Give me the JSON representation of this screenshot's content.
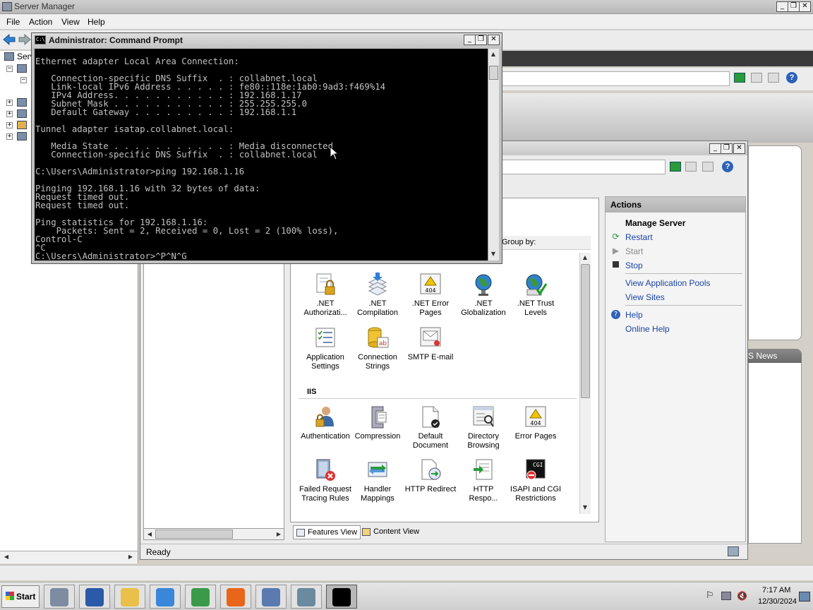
{
  "server_manager": {
    "title": "Server Manager",
    "menu": [
      "File",
      "Action",
      "View",
      "Help"
    ],
    "tree_label": "Serv",
    "news_header": "S News",
    "title_buttons": [
      "_",
      "❐",
      "✕"
    ]
  },
  "cmd": {
    "title": "Administrator: Command Prompt",
    "icon_text": "C:\\",
    "lines": [
      "Ethernet adapter Local Area Connection:",
      "",
      "   Connection-specific DNS Suffix  . : collabnet.local",
      "   Link-local IPv6 Address . . . . . : fe80::118e:1ab0:9ad3:f469%14",
      "   IPv4 Address. . . . . . . . . . . : 192.168.1.17",
      "   Subnet Mask . . . . . . . . . . . : 255.255.255.0",
      "   Default Gateway . . . . . . . . . : 192.168.1.1",
      "",
      "Tunnel adapter isatap.collabnet.local:",
      "",
      "   Media State . . . . . . . . . . . : Media disconnected",
      "   Connection-specific DNS Suffix  . : collabnet.local",
      "",
      "C:\\Users\\Administrator>ping 192.168.1.16",
      "",
      "Pinging 192.168.1.16 with 32 bytes of data:",
      "Request timed out.",
      "Request timed out.",
      "",
      "Ping statistics for 192.168.1.16:",
      "    Packets: Sent = 2, Received = 0, Lost = 2 (100% loss),",
      "Control-C",
      "^C",
      "C:\\Users\\Administrator>^P^N^G"
    ]
  },
  "iis": {
    "group_by_label": "Group by:",
    "status": "Ready",
    "group_iis": "IIS",
    "features_top": [
      {
        "label1": ".NET",
        "label2": "Authorizati...",
        "icon": "lock-document-icon"
      },
      {
        "label1": ".NET",
        "label2": "Compilation",
        "icon": "compile-arrow-icon"
      },
      {
        "label1": ".NET Error",
        "label2": "Pages",
        "icon": "error-page-404-icon"
      },
      {
        "label1": ".NET",
        "label2": "Globalization",
        "icon": "globe-icon"
      },
      {
        "label1": ".NET Trust",
        "label2": "Levels",
        "icon": "globe-check-icon"
      },
      {
        "label1": "Application",
        "label2": "Settings",
        "icon": "settings-list-icon"
      },
      {
        "label1": "Connection",
        "label2": "Strings",
        "icon": "database-ab-icon"
      },
      {
        "label1": "SMTP E-mail",
        "label2": "",
        "icon": "email-icon"
      }
    ],
    "features_iis": [
      {
        "label1": "Authentication",
        "label2": "",
        "icon": "user-lock-icon"
      },
      {
        "label1": "Compression",
        "label2": "",
        "icon": "compression-clamp-icon"
      },
      {
        "label1": "Default",
        "label2": "Document",
        "icon": "default-document-icon"
      },
      {
        "label1": "Directory",
        "label2": "Browsing",
        "icon": "directory-browse-icon"
      },
      {
        "label1": "Error Pages",
        "label2": "",
        "icon": "error-page-icon"
      },
      {
        "label1": "Failed Request",
        "label2": "Tracing Rules",
        "icon": "failed-request-icon"
      },
      {
        "label1": "Handler",
        "label2": "Mappings",
        "icon": "handler-mappings-icon"
      },
      {
        "label1": "HTTP Redirect",
        "label2": "",
        "icon": "http-redirect-icon"
      },
      {
        "label1": "HTTP",
        "label2": "Respo...",
        "icon": "http-response-icon"
      },
      {
        "label1": "ISAPI and CGI",
        "label2": "Restrictions",
        "icon": "isapi-cgi-icon"
      }
    ],
    "tabs": {
      "features": "Features View",
      "content": "Content View"
    },
    "actions": {
      "header": "Actions",
      "section": "Manage Server",
      "restart": "Restart",
      "start": "Start",
      "stop": "Stop",
      "app_pools": "View Application Pools",
      "sites": "View Sites",
      "help": "Help",
      "online_help": "Online Help"
    }
  },
  "taskbar": {
    "start_label": "Start",
    "time": "7:17 AM",
    "date": "12/30/2024",
    "buttons": [
      {
        "name": "server-manager-task-icon",
        "color": "#7d8ca0"
      },
      {
        "name": "powershell-task-icon",
        "color": "#2a5aa8"
      },
      {
        "name": "folder-task-icon",
        "color": "#e8c04a"
      },
      {
        "name": "internet-explorer-task-icon",
        "color": "#3a86d8"
      },
      {
        "name": "chrome-task-icon",
        "color": "#3a9a4a"
      },
      {
        "name": "firefox-task-icon",
        "color": "#e8661a"
      },
      {
        "name": "network-task-icon",
        "color": "#5a7ab0"
      },
      {
        "name": "iis-task-icon",
        "color": "#6a8aa0"
      },
      {
        "name": "command-prompt-task-icon",
        "color": "#000000"
      }
    ]
  },
  "colors": {
    "accent_link": "#1a44a8",
    "console_bg": "#000000",
    "console_fg": "#c0c0c0"
  }
}
